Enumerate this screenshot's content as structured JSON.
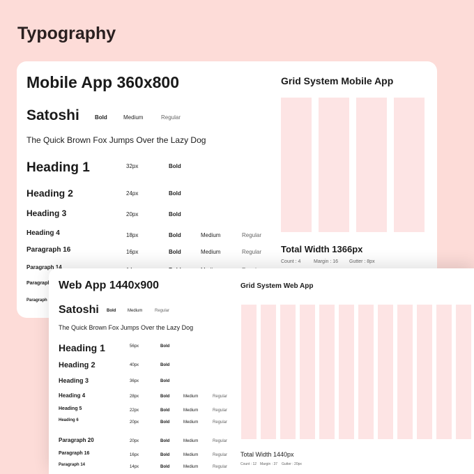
{
  "title": "Typography",
  "mobile": {
    "title": "Mobile App 360x800",
    "font": "Satoshi",
    "weights": [
      "Bold",
      "Medium",
      "Regular"
    ],
    "sample": "The Quick Brown Fox Jumps Over the Lazy Dog",
    "rows": [
      {
        "name": "Heading 1",
        "size": "32px",
        "w": [
          "Bold"
        ]
      },
      {
        "name": "Heading 2",
        "size": "24px",
        "w": [
          "Bold"
        ]
      },
      {
        "name": "Heading 3",
        "size": "20px",
        "w": [
          "Bold"
        ]
      },
      {
        "name": "Heading 4",
        "size": "18px",
        "w": [
          "Bold",
          "Medium",
          "Regular"
        ]
      },
      {
        "name": "Paragraph 16",
        "size": "16px",
        "w": [
          "Bold",
          "Medium",
          "Regular"
        ]
      },
      {
        "name": "Paragraph 14",
        "size": "14px",
        "w": [
          "Bold",
          "Medium",
          "Regular"
        ]
      },
      {
        "name": "Paragraph",
        "size": "",
        "w": []
      },
      {
        "name": "Paragraph",
        "size": "",
        "w": []
      }
    ],
    "grid": {
      "title": "Grid System Mobile App",
      "total": "Total Width 1366px",
      "count": "Count : 4",
      "margin": "Margin : 16",
      "gutter": "Gutter : 8px"
    }
  },
  "web": {
    "title": "Web App 1440x900",
    "font": "Satoshi",
    "weights": [
      "Bold",
      "Medium",
      "Regular"
    ],
    "sample": "The Quick Brown Fox Jumps Over the Lazy Dog",
    "rows": [
      {
        "name": "Heading 1",
        "size": "56px",
        "w": [
          "Bold"
        ]
      },
      {
        "name": "Heading 2",
        "size": "40px",
        "w": [
          "Bold"
        ]
      },
      {
        "name": "Heading 3",
        "size": "36px",
        "w": [
          "Bold"
        ]
      },
      {
        "name": "Heading 4",
        "size": "28px",
        "w": [
          "Bold",
          "Medium",
          "Regular"
        ]
      },
      {
        "name": "Heading 5",
        "size": "22px",
        "w": [
          "Bold",
          "Medium",
          "Regular"
        ]
      },
      {
        "name": "Heading 6",
        "size": "20px",
        "w": [
          "Bold",
          "Medium",
          "Regular"
        ]
      },
      {
        "name": "Paragraph 20",
        "size": "20px",
        "w": [
          "Bold",
          "Medium",
          "Regular"
        ]
      },
      {
        "name": "Paragraph 16",
        "size": "16px",
        "w": [
          "Bold",
          "Medium",
          "Regular"
        ]
      },
      {
        "name": "Paragraph 14",
        "size": "14px",
        "w": [
          "Bold",
          "Medium",
          "Regular"
        ]
      }
    ],
    "grid": {
      "title": "Grid System Web App",
      "total": "Total Width 1440px",
      "count": "Count : 12",
      "margin": "Margin : 37",
      "gutter": "Gutter : 20px"
    }
  }
}
